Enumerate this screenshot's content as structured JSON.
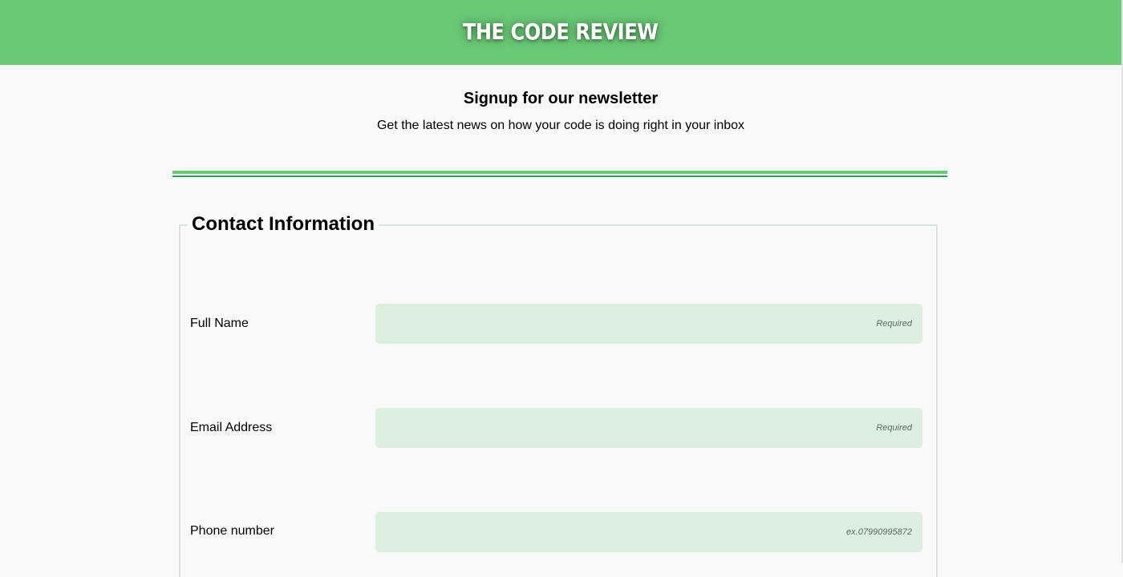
{
  "header": {
    "brand": "THE CODE REVIEW",
    "background_color": "#69c975"
  },
  "intro": {
    "title": "Signup for our newsletter",
    "subtitle": "Get the latest news on how your code is doing right in your inbox"
  },
  "form": {
    "legend": "Contact Information",
    "fields": [
      {
        "label": "Full Name",
        "value": "",
        "placeholder": "Required"
      },
      {
        "label": "Email Address",
        "value": "",
        "placeholder": "Required"
      },
      {
        "label": "Phone number",
        "value": "",
        "placeholder": "ex.07990995872"
      }
    ],
    "input_background_color": "#dcefe0"
  }
}
